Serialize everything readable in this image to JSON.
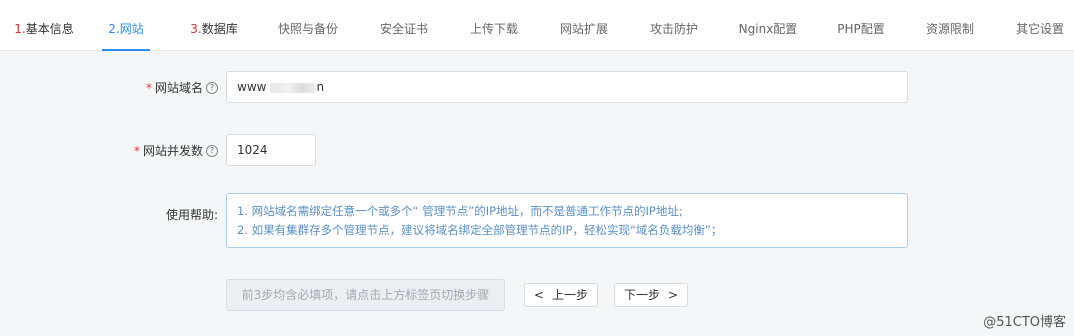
{
  "tabs": [
    {
      "num": "1.",
      "label": "基本信息",
      "state": "done"
    },
    {
      "num": "2.",
      "label": "网站",
      "state": "active"
    },
    {
      "num": "3.",
      "label": "数据库",
      "state": "done"
    },
    {
      "label": "快照与备份"
    },
    {
      "label": "安全证书"
    },
    {
      "label": "上传下载"
    },
    {
      "label": "网站扩展"
    },
    {
      "label": "攻击防护"
    },
    {
      "label": "Nginx配置"
    },
    {
      "label": "PHP配置"
    },
    {
      "label": "资源限制"
    },
    {
      "label": "其它设置"
    }
  ],
  "form": {
    "domain_label": "网站域名",
    "domain_value_prefix": "www",
    "domain_value_suffix": "n",
    "concurrency_label": "网站并发数",
    "concurrency_value": "1024",
    "required_mark": "*",
    "help_icon": "?",
    "help_label": "使用帮助:",
    "help_lines": [
      "1. 网站域名需绑定任意一个或多个“ 管理节点”的IP地址，而不是普通工作节点的IP地址;",
      "2. 如果有集群存多个管理节点，建议将域名绑定全部管理节点的IP，轻松实现“域名负载均衡”；"
    ]
  },
  "buttons": {
    "required_notice": "前3步均含必填项，请点击上方标签页切换步骤",
    "prev": "上一步",
    "prev_icon": "<",
    "next": "下一步",
    "next_icon": ">"
  },
  "watermark": "@51CTO博客"
}
